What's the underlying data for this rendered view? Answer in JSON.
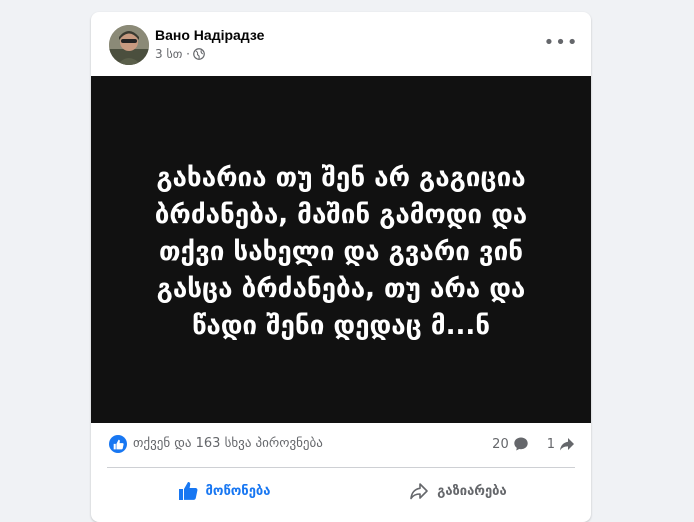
{
  "post": {
    "author": "Вано Надірадзе",
    "time": "3 სთ ·",
    "privacy_icon": "globe-icon",
    "more_icon": "more-options-icon",
    "image_text": "გახარია თუ შენ არ გაგიცია ბრძანება, მაშინ გამოდი და თქვი სახელი და გვარი ვინ გასცა ბრძანება, თუ არა და წადი შენი დედაც მ...ნ"
  },
  "reactions": {
    "summary": "თქვენ და 163 სხვა პიროვნება",
    "comments_count": "20",
    "shares_count": "1"
  },
  "actions": {
    "like_label": "მოწონება",
    "share_label": "გაზიარება"
  },
  "colors": {
    "accent": "#1877f2",
    "muted": "#65676b",
    "image_bg": "#111111"
  }
}
